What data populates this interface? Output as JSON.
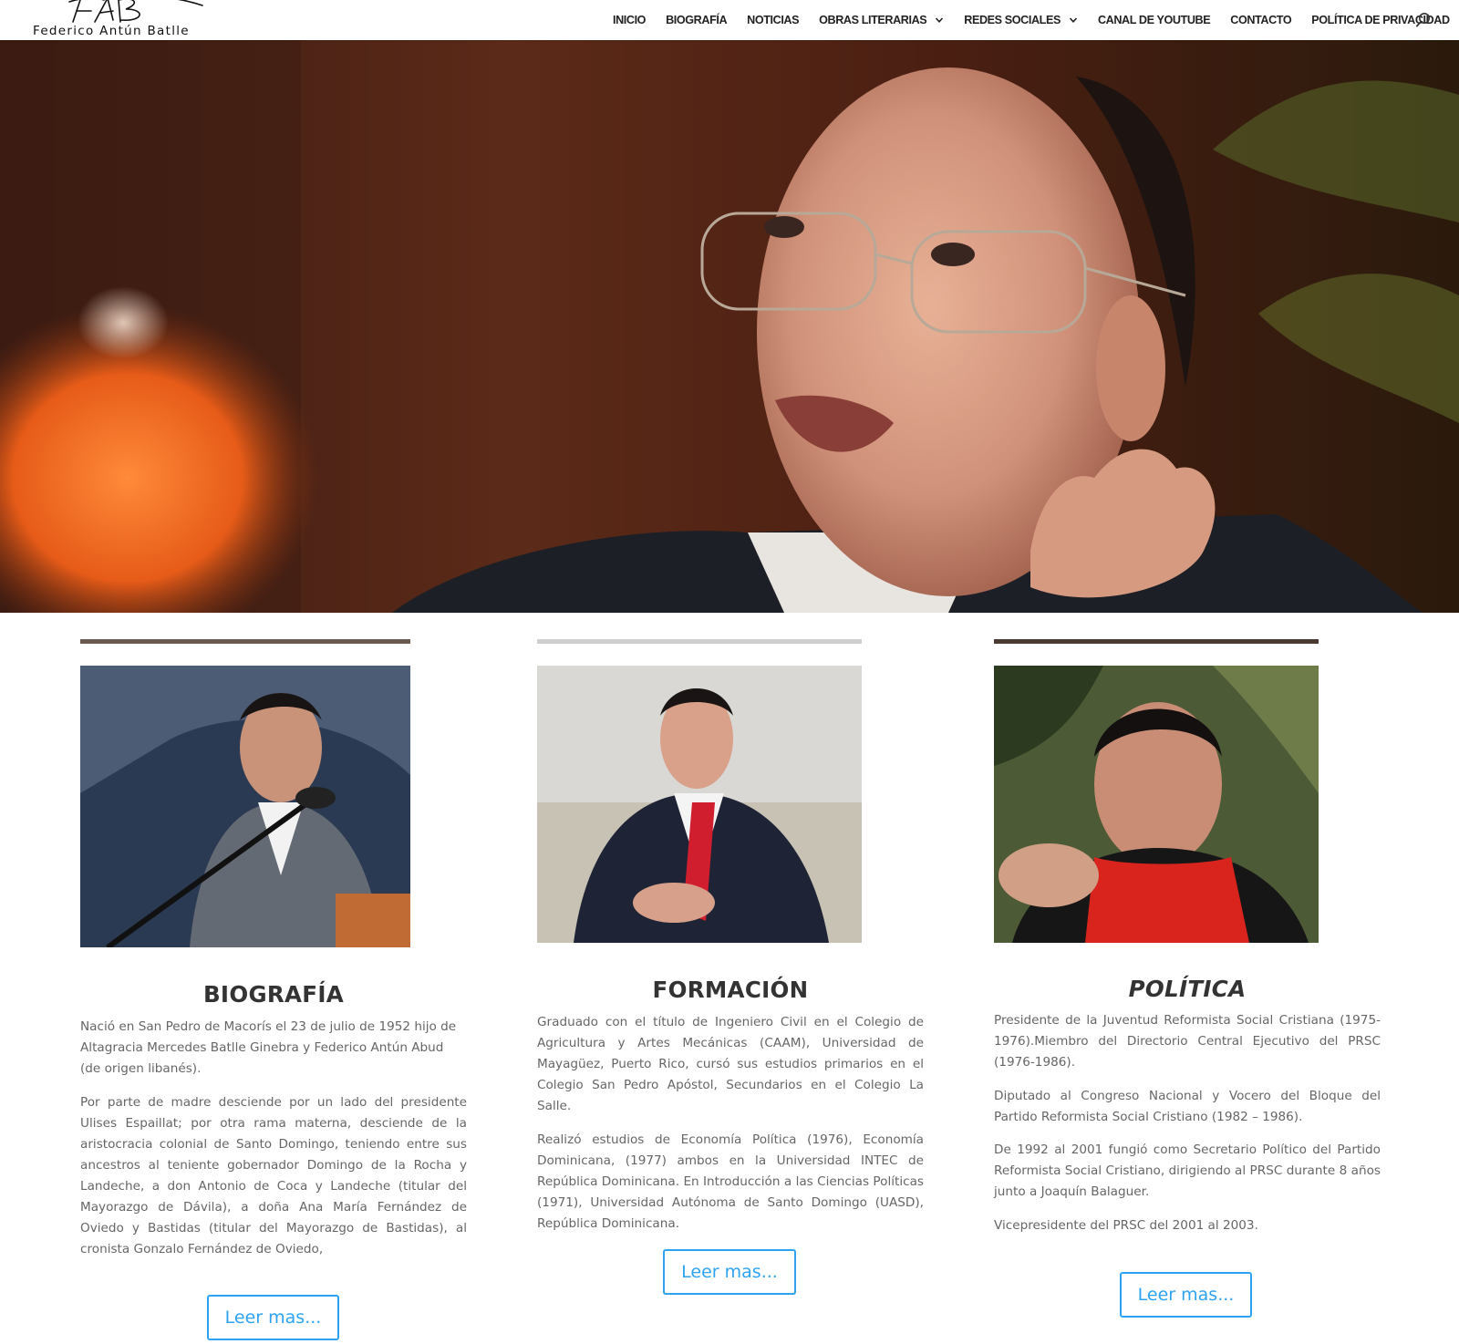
{
  "header": {
    "logo_text": "Federico Antún Batlle",
    "nav": [
      {
        "label": "INICIO",
        "has_dropdown": false
      },
      {
        "label": "BIOGRAFÍA",
        "has_dropdown": false
      },
      {
        "label": "NOTICIAS",
        "has_dropdown": false
      },
      {
        "label": "OBRAS LITERARIAS",
        "has_dropdown": true
      },
      {
        "label": "REDES SOCIALES",
        "has_dropdown": true
      },
      {
        "label": "CANAL DE YOUTUBE",
        "has_dropdown": false
      },
      {
        "label": "CONTACTO",
        "has_dropdown": false
      },
      {
        "label": "POLÍTICA DE PRIVACIDAD",
        "has_dropdown": false
      }
    ],
    "search_icon": "search-icon"
  },
  "colors": {
    "accent": "#2ea3f2",
    "title": "#333333",
    "body_text": "#666666",
    "nav_text": "#222222"
  },
  "columns": [
    {
      "title": "BIOGRAFÍA",
      "title_italic": false,
      "paragraphs": [
        "Nació en San Pedro de Macorís el 23 de julio de 1952 hijo de Altagracia Mercedes Batlle Ginebra y Federico Antún Abud (de origen libanés).",
        "Por parte de madre desciende por un lado del presidente Ulises Espaillat; por otra rama materna, desciende de la aristocracia colonial de Santo Domingo, teniendo entre sus ancestros al teniente gobernador Domingo de la Rocha y Landeche, a don Antonio de Coca y Landeche (titular del Mayorazgo de Dávila), a doña Ana María Fernández de Oviedo y Bastidas (titular del Mayorazgo de Bastidas), al cronista Gonzalo Fernández de Oviedo,"
      ],
      "button": "Leer mas..."
    },
    {
      "title": "FORMACIÓN",
      "title_italic": false,
      "paragraphs": [
        "Graduado con el título de Ingeniero Civil en el Colegio de Agricultura y Artes Mecánicas (CAAM), Universidad de Mayagüez, Puerto Rico, cursó sus estudios primarios en el Colegio San Pedro Apóstol, Secundarios en el Colegio La Salle.",
        "Realizó estudios de Economía Política (1976), Economía Dominicana, (1977) ambos en la Universidad INTEC de República Dominicana. En Introducción a las Ciencias Políticas (1971), Universidad Autónoma de Santo Domingo (UASD), República Dominicana."
      ],
      "button": "Leer mas..."
    },
    {
      "title": "POLÍTICA",
      "title_italic": true,
      "paragraphs": [
        "Presidente de la Juventud Reformista Social Cristiana (1975-1976).Miembro del Directorio Central Ejecutivo del PRSC (1976-1986).",
        "Diputado al Congreso Nacional y Vocero del Bloque del Partido Reformista Social Cristiano (1982 – 1986).",
        "De 1992 al 2001 fungió como Secretario Político del Partido Reformista Social Cristiano, dirigiendo al PRSC durante 8 años junto a Joaquín Balaguer.",
        "Vicepresidente del PRSC del 2001 al 2003."
      ],
      "button": "Leer mas..."
    }
  ]
}
